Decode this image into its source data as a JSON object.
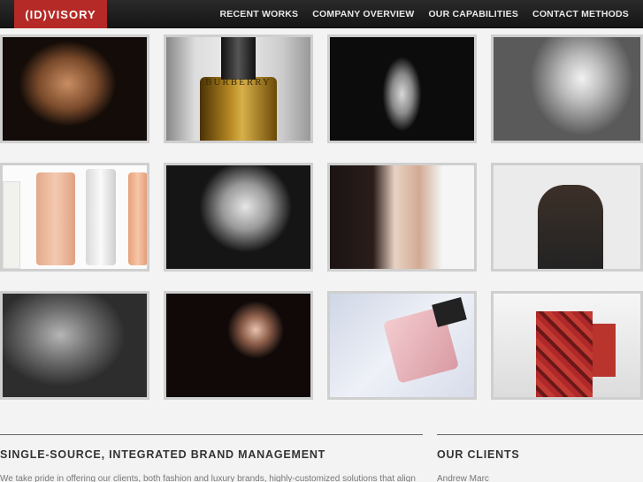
{
  "header": {
    "logo": "(ID)VISORY",
    "nav": [
      "RECENT WORKS",
      "COMPANY OVERVIEW",
      "OUR CAPABILITIES",
      "CONTACT METHODS"
    ]
  },
  "gallery": {
    "items": [
      {
        "name": "portrait-woman-dark-dress"
      },
      {
        "name": "burberry-fragrance-bottle",
        "text": "BURBERRY"
      },
      {
        "name": "runway-model-gown"
      },
      {
        "name": "blonde-model-bw-portrait"
      },
      {
        "name": "lancome-skincare-products"
      },
      {
        "name": "kate-moss-bw-watch"
      },
      {
        "name": "megan-fox-portrait"
      },
      {
        "name": "model-fur-collar-coat"
      },
      {
        "name": "bw-model-leather-jacket"
      },
      {
        "name": "model-veil-dark-portrait"
      },
      {
        "name": "perfume-splash-bottle"
      },
      {
        "name": "runway-plaid-coat"
      }
    ]
  },
  "sections": {
    "brand_title": "SINGLE-SOURCE, INTEGRATED BRAND MANAGEMENT",
    "brand_text": "We take pride in offering our clients, both fashion and luxury brands, highly-customized solutions that align",
    "clients_title": "OUR CLIENTS",
    "clients_first": "Andrew Marc"
  }
}
